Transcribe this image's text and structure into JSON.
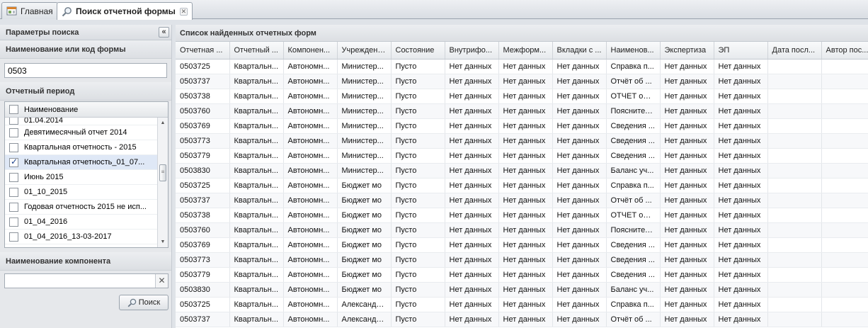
{
  "tabs": [
    {
      "label": "Главная",
      "icon": "home-icon",
      "active": false
    },
    {
      "label": "Поиск отчетной формы",
      "icon": "search-icon",
      "active": true,
      "closable": true
    }
  ],
  "left_panel": {
    "title": "Параметры поиска",
    "form_name_label": "Наименование или код формы",
    "form_name_value": "0503",
    "period_label": "Отчетный период",
    "period_column": "Наименование",
    "periods": [
      {
        "name": "01.04.2014",
        "checked": false
      },
      {
        "name": "Девятимесячный отчет 2014",
        "checked": false
      },
      {
        "name": "Квартальная отчетность - 2015",
        "checked": false
      },
      {
        "name": "Квартальная отчетность_01_07...",
        "checked": true
      },
      {
        "name": "Июнь 2015",
        "checked": false
      },
      {
        "name": "01_10_2015",
        "checked": false
      },
      {
        "name": "Годовая отчетность 2015 не исп...",
        "checked": false
      },
      {
        "name": "01_04_2016",
        "checked": false
      },
      {
        "name": "01_04_2016_13-03-2017",
        "checked": false
      }
    ],
    "component_label": "Наименование компонента",
    "component_value": "",
    "search_button": "Поиск"
  },
  "results": {
    "title": "Список найденных отчетных форм",
    "columns": [
      "Отчетная ...",
      "Отчетный ...",
      "Компонен...",
      "Учреждение",
      "Состояние",
      "Внутрифо...",
      "Межформ...",
      "Вкладки с ...",
      "Наименов...",
      "Экспертиза",
      "ЭП",
      "Дата посл...",
      "Автор пос..."
    ],
    "rows": [
      [
        "0503725",
        "Квартальн...",
        "Автономн...",
        "Министер...",
        "Пусто",
        "Нет данных",
        "Нет данных",
        "Нет данных",
        "Справка п...",
        "Нет данных",
        "Нет данных",
        "",
        ""
      ],
      [
        "0503737",
        "Квартальн...",
        "Автономн...",
        "Министер...",
        "Пусто",
        "Нет данных",
        "Нет данных",
        "Нет данных",
        "Отчёт об ...",
        "Нет данных",
        "Нет данных",
        "",
        ""
      ],
      [
        "0503738",
        "Квартальн...",
        "Автономн...",
        "Министер...",
        "Пусто",
        "Нет данных",
        "Нет данных",
        "Нет данных",
        "ОТЧЕТ об ...",
        "Нет данных",
        "Нет данных",
        "",
        ""
      ],
      [
        "0503760",
        "Квартальн...",
        "Автономн...",
        "Министер...",
        "Пусто",
        "Нет данных",
        "Нет данных",
        "Нет данных",
        "Пояснител...",
        "Нет данных",
        "Нет данных",
        "",
        ""
      ],
      [
        "0503769",
        "Квартальн...",
        "Автономн...",
        "Министер...",
        "Пусто",
        "Нет данных",
        "Нет данных",
        "Нет данных",
        "Сведения ...",
        "Нет данных",
        "Нет данных",
        "",
        ""
      ],
      [
        "0503773",
        "Квартальн...",
        "Автономн...",
        "Министер...",
        "Пусто",
        "Нет данных",
        "Нет данных",
        "Нет данных",
        "Сведения ...",
        "Нет данных",
        "Нет данных",
        "",
        ""
      ],
      [
        "0503779",
        "Квартальн...",
        "Автономн...",
        "Министер...",
        "Пусто",
        "Нет данных",
        "Нет данных",
        "Нет данных",
        "Сведения ...",
        "Нет данных",
        "Нет данных",
        "",
        ""
      ],
      [
        "0503830",
        "Квартальн...",
        "Автономн...",
        "Министер...",
        "Пусто",
        "Нет данных",
        "Нет данных",
        "Нет данных",
        "Баланс уч...",
        "Нет данных",
        "Нет данных",
        "",
        ""
      ],
      [
        "0503725",
        "Квартальн...",
        "Автономн...",
        "Бюджет мо",
        "Пусто",
        "Нет данных",
        "Нет данных",
        "Нет данных",
        "Справка п...",
        "Нет данных",
        "Нет данных",
        "",
        ""
      ],
      [
        "0503737",
        "Квартальн...",
        "Автономн...",
        "Бюджет мо",
        "Пусто",
        "Нет данных",
        "Нет данных",
        "Нет данных",
        "Отчёт об ...",
        "Нет данных",
        "Нет данных",
        "",
        ""
      ],
      [
        "0503738",
        "Квартальн...",
        "Автономн...",
        "Бюджет мо",
        "Пусто",
        "Нет данных",
        "Нет данных",
        "Нет данных",
        "ОТЧЕТ об ...",
        "Нет данных",
        "Нет данных",
        "",
        ""
      ],
      [
        "0503760",
        "Квартальн...",
        "Автономн...",
        "Бюджет мо",
        "Пусто",
        "Нет данных",
        "Нет данных",
        "Нет данных",
        "Пояснител...",
        "Нет данных",
        "Нет данных",
        "",
        ""
      ],
      [
        "0503769",
        "Квартальн...",
        "Автономн...",
        "Бюджет мо",
        "Пусто",
        "Нет данных",
        "Нет данных",
        "Нет данных",
        "Сведения ...",
        "Нет данных",
        "Нет данных",
        "",
        ""
      ],
      [
        "0503773",
        "Квартальн...",
        "Автономн...",
        "Бюджет мо",
        "Пусто",
        "Нет данных",
        "Нет данных",
        "Нет данных",
        "Сведения ...",
        "Нет данных",
        "Нет данных",
        "",
        ""
      ],
      [
        "0503779",
        "Квартальн...",
        "Автономн...",
        "Бюджет мо",
        "Пусто",
        "Нет данных",
        "Нет данных",
        "Нет данных",
        "Сведения ...",
        "Нет данных",
        "Нет данных",
        "",
        ""
      ],
      [
        "0503830",
        "Квартальн...",
        "Автономн...",
        "Бюджет мо",
        "Пусто",
        "Нет данных",
        "Нет данных",
        "Нет данных",
        "Баланс уч...",
        "Нет данных",
        "Нет данных",
        "",
        ""
      ],
      [
        "0503725",
        "Квартальн...",
        "Автономн...",
        "Александр...",
        "Пусто",
        "Нет данных",
        "Нет данных",
        "Нет данных",
        "Справка п...",
        "Нет данных",
        "Нет данных",
        "",
        ""
      ],
      [
        "0503737",
        "Квартальн...",
        "Автономн...",
        "Александр...",
        "Пусто",
        "Нет данных",
        "Нет данных",
        "Нет данных",
        "Отчёт об ...",
        "Нет данных",
        "Нет данных",
        "",
        ""
      ]
    ]
  }
}
